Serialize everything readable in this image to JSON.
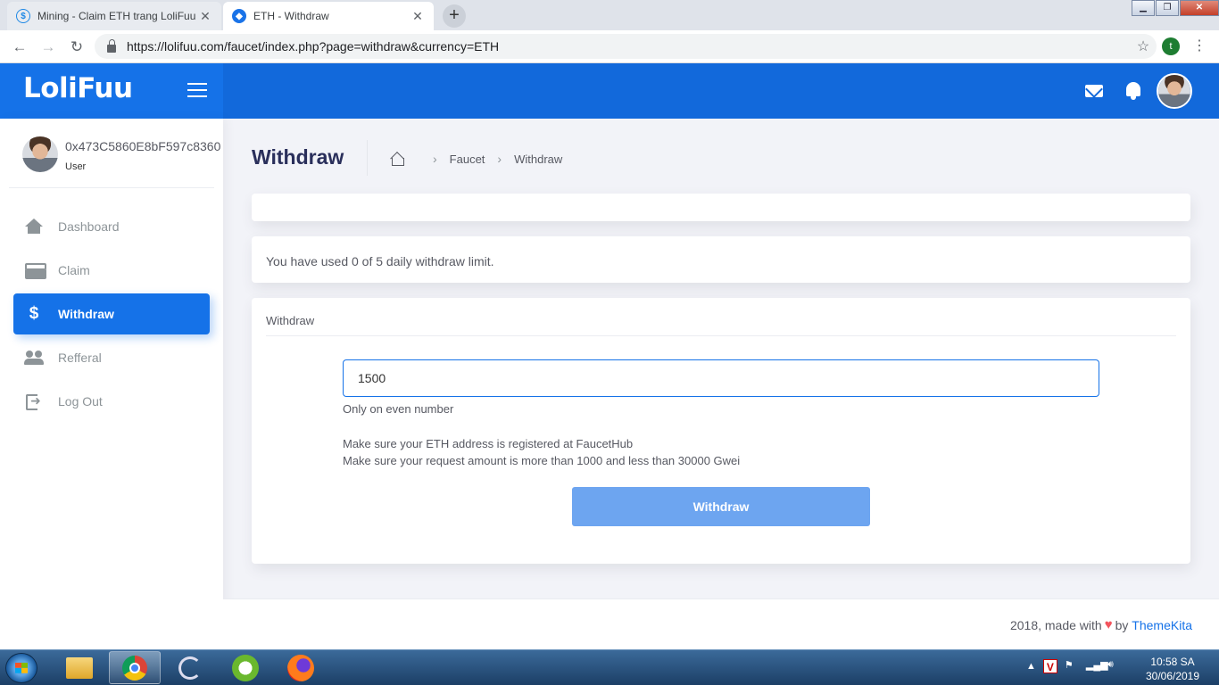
{
  "browser": {
    "tabs": [
      {
        "title": "Mining - Claim ETH trang LoliFuu",
        "favicon": "dollar-circle-icon",
        "active": false
      },
      {
        "title": "ETH - Withdraw",
        "favicon": "site-icon",
        "active": true
      }
    ],
    "url": "https://lolifuu.com/faucet/index.php?page=withdraw&currency=ETH",
    "profile_initial": "t"
  },
  "header": {
    "logo": "LoliFuu"
  },
  "sidebar": {
    "user_name": "0x473C5860E8bF597c8360",
    "user_role": "User",
    "items": [
      {
        "label": "Dashboard",
        "icon": "home-icon",
        "active": false
      },
      {
        "label": "Claim",
        "icon": "coins-icon",
        "active": false
      },
      {
        "label": "Withdraw",
        "icon": "dollar-icon",
        "active": true
      },
      {
        "label": "Refferal",
        "icon": "users-icon",
        "active": false
      },
      {
        "label": "Log Out",
        "icon": "logout-icon",
        "active": false
      }
    ]
  },
  "page": {
    "title": "Withdraw",
    "breadcrumb": [
      "Faucet",
      "Withdraw"
    ],
    "limit_text": "You have used 0 of 5 daily withdraw limit.",
    "card_title": "Withdraw",
    "amount_value": "1500",
    "help_text": "Only on even number",
    "note1": "Make sure your ETH address is registered at FaucetHub",
    "note2": "Make sure your request amount is more than 1000 and less than 30000 Gwei",
    "button_label": "Withdraw"
  },
  "footer": {
    "text": "2018, made with",
    "by": "by",
    "link": "ThemeKita"
  },
  "taskbar": {
    "time": "10:58 SA",
    "date": "30/06/2019"
  },
  "colors": {
    "primary": "#1572e8",
    "header_bg": "#1269db",
    "button_disabled": "#6da5f0",
    "heart": "#f3545d"
  }
}
